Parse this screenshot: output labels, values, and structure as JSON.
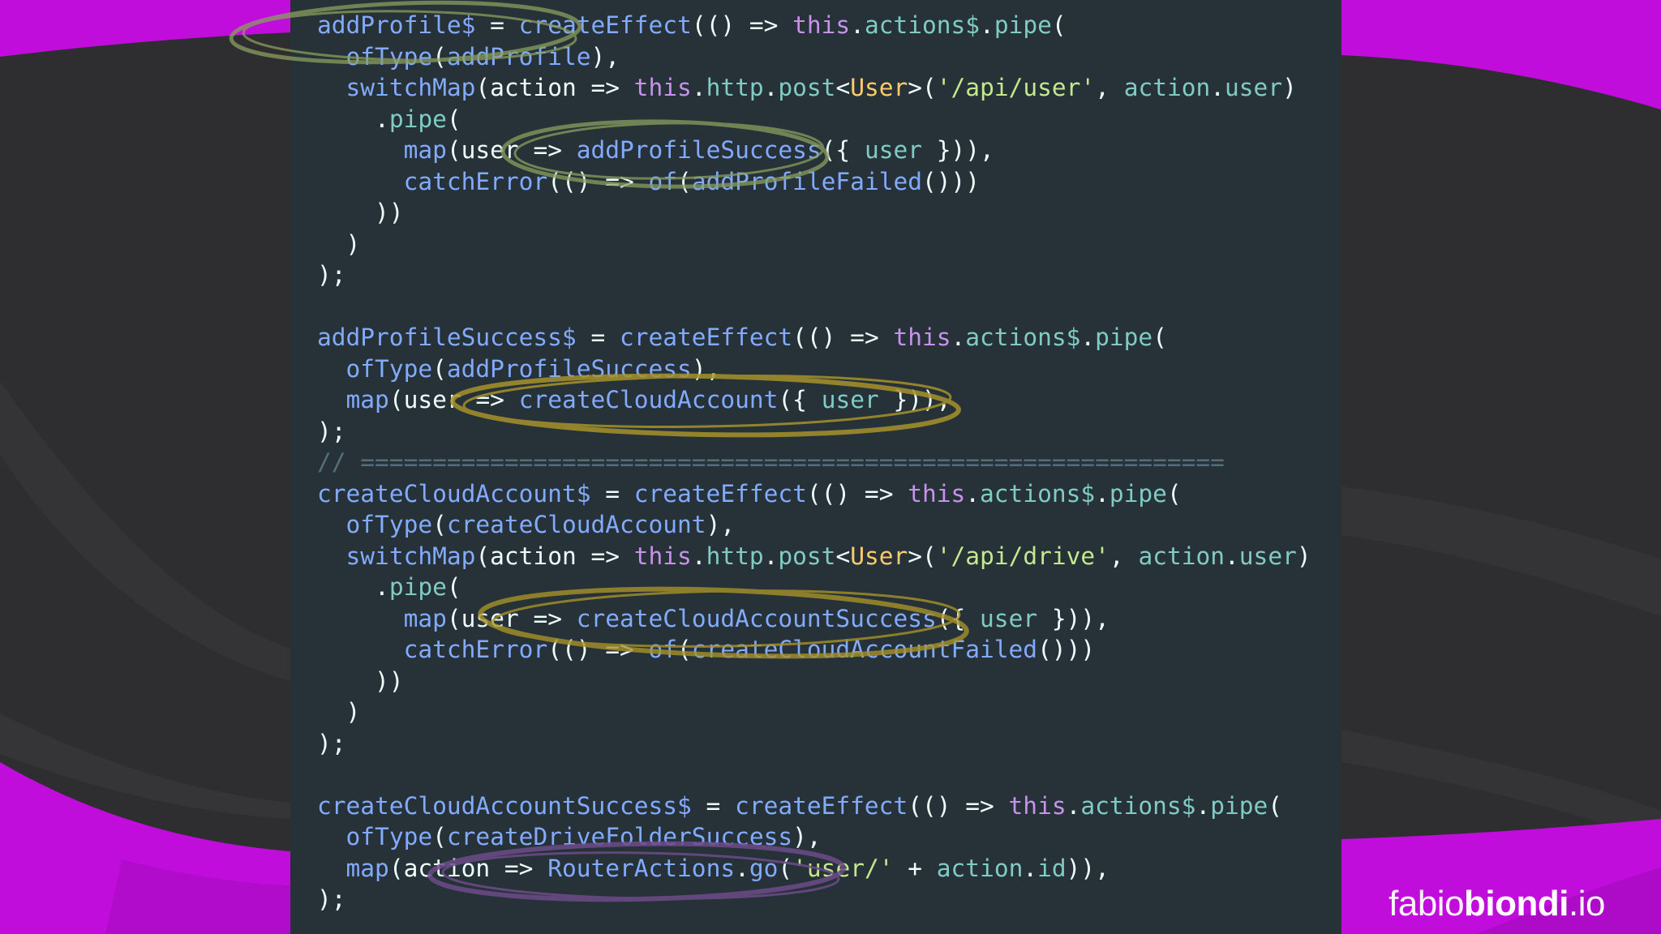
{
  "colors": {
    "background": "#2e2e31",
    "magenta": "#c10ddc",
    "panel": "#263238",
    "circle_green": "#8a9f5e",
    "circle_gold": "#a7922a",
    "circle_purple": "#6d4b8a"
  },
  "code_lines": [
    [
      {
        "t": "addProfile$",
        "c": "fn"
      },
      {
        "t": " = ",
        "c": "pl"
      },
      {
        "t": "createEffect",
        "c": "fn"
      },
      {
        "t": "(() => ",
        "c": "pl"
      },
      {
        "t": "this",
        "c": "kw"
      },
      {
        "t": ".",
        "c": "pl"
      },
      {
        "t": "actions$",
        "c": "pp"
      },
      {
        "t": ".",
        "c": "pl"
      },
      {
        "t": "pipe",
        "c": "pp"
      },
      {
        "t": "(",
        "c": "pl"
      }
    ],
    [
      {
        "t": "  ",
        "c": "pl"
      },
      {
        "t": "ofType",
        "c": "fn"
      },
      {
        "t": "(",
        "c": "pl"
      },
      {
        "t": "addProfile",
        "c": "fn"
      },
      {
        "t": "),",
        "c": "pl"
      }
    ],
    [
      {
        "t": "  ",
        "c": "pl"
      },
      {
        "t": "switchMap",
        "c": "fn"
      },
      {
        "t": "(action => ",
        "c": "pl"
      },
      {
        "t": "this",
        "c": "kw"
      },
      {
        "t": ".",
        "c": "pl"
      },
      {
        "t": "http",
        "c": "pp"
      },
      {
        "t": ".",
        "c": "pl"
      },
      {
        "t": "post",
        "c": "pp"
      },
      {
        "t": "<",
        "c": "pl"
      },
      {
        "t": "User",
        "c": "ty"
      },
      {
        "t": ">(",
        "c": "pl"
      },
      {
        "t": "'/api/user'",
        "c": "st"
      },
      {
        "t": ", ",
        "c": "pl"
      },
      {
        "t": "action",
        "c": "pp"
      },
      {
        "t": ".",
        "c": "pl"
      },
      {
        "t": "user",
        "c": "pp"
      },
      {
        "t": ")",
        "c": "pl"
      }
    ],
    [
      {
        "t": "    .",
        "c": "pl"
      },
      {
        "t": "pipe",
        "c": "pp"
      },
      {
        "t": "(",
        "c": "pl"
      }
    ],
    [
      {
        "t": "      ",
        "c": "pl"
      },
      {
        "t": "map",
        "c": "fn"
      },
      {
        "t": "(user => ",
        "c": "pl"
      },
      {
        "t": "addProfileSuccess",
        "c": "fn"
      },
      {
        "t": "({ ",
        "c": "pl"
      },
      {
        "t": "user",
        "c": "pp"
      },
      {
        "t": " })),",
        "c": "pl"
      }
    ],
    [
      {
        "t": "      ",
        "c": "pl"
      },
      {
        "t": "catchError",
        "c": "fn"
      },
      {
        "t": "(() => ",
        "c": "pl"
      },
      {
        "t": "of",
        "c": "fn"
      },
      {
        "t": "(",
        "c": "pl"
      },
      {
        "t": "addProfileFailed",
        "c": "fn"
      },
      {
        "t": "()))",
        "c": "pl"
      }
    ],
    [
      {
        "t": "    ))",
        "c": "pl"
      }
    ],
    [
      {
        "t": "  )",
        "c": "pl"
      }
    ],
    [
      {
        "t": ");",
        "c": "pl"
      }
    ],
    [],
    [
      {
        "t": "addProfileSuccess$",
        "c": "fn"
      },
      {
        "t": " = ",
        "c": "pl"
      },
      {
        "t": "createEffect",
        "c": "fn"
      },
      {
        "t": "(() => ",
        "c": "pl"
      },
      {
        "t": "this",
        "c": "kw"
      },
      {
        "t": ".",
        "c": "pl"
      },
      {
        "t": "actions$",
        "c": "pp"
      },
      {
        "t": ".",
        "c": "pl"
      },
      {
        "t": "pipe",
        "c": "pp"
      },
      {
        "t": "(",
        "c": "pl"
      }
    ],
    [
      {
        "t": "  ",
        "c": "pl"
      },
      {
        "t": "ofType",
        "c": "fn"
      },
      {
        "t": "(",
        "c": "pl"
      },
      {
        "t": "addProfileSuccess",
        "c": "fn"
      },
      {
        "t": "),",
        "c": "pl"
      }
    ],
    [
      {
        "t": "  ",
        "c": "pl"
      },
      {
        "t": "map",
        "c": "fn"
      },
      {
        "t": "(user => ",
        "c": "pl"
      },
      {
        "t": "createCloudAccount",
        "c": "fn"
      },
      {
        "t": "({ ",
        "c": "pl"
      },
      {
        "t": "user",
        "c": "pp"
      },
      {
        "t": " })),",
        "c": "pl"
      }
    ],
    [
      {
        "t": ");",
        "c": "pl"
      }
    ],
    [
      {
        "t": "// ============================================================",
        "c": "cm"
      }
    ],
    [
      {
        "t": "createCloudAccount$",
        "c": "fn"
      },
      {
        "t": " = ",
        "c": "pl"
      },
      {
        "t": "createEffect",
        "c": "fn"
      },
      {
        "t": "(() => ",
        "c": "pl"
      },
      {
        "t": "this",
        "c": "kw"
      },
      {
        "t": ".",
        "c": "pl"
      },
      {
        "t": "actions$",
        "c": "pp"
      },
      {
        "t": ".",
        "c": "pl"
      },
      {
        "t": "pipe",
        "c": "pp"
      },
      {
        "t": "(",
        "c": "pl"
      }
    ],
    [
      {
        "t": "  ",
        "c": "pl"
      },
      {
        "t": "ofType",
        "c": "fn"
      },
      {
        "t": "(",
        "c": "pl"
      },
      {
        "t": "createCloudAccount",
        "c": "fn"
      },
      {
        "t": "),",
        "c": "pl"
      }
    ],
    [
      {
        "t": "  ",
        "c": "pl"
      },
      {
        "t": "switchMap",
        "c": "fn"
      },
      {
        "t": "(action => ",
        "c": "pl"
      },
      {
        "t": "this",
        "c": "kw"
      },
      {
        "t": ".",
        "c": "pl"
      },
      {
        "t": "http",
        "c": "pp"
      },
      {
        "t": ".",
        "c": "pl"
      },
      {
        "t": "post",
        "c": "pp"
      },
      {
        "t": "<",
        "c": "pl"
      },
      {
        "t": "User",
        "c": "ty"
      },
      {
        "t": ">(",
        "c": "pl"
      },
      {
        "t": "'/api/drive'",
        "c": "st"
      },
      {
        "t": ", ",
        "c": "pl"
      },
      {
        "t": "action",
        "c": "pp"
      },
      {
        "t": ".",
        "c": "pl"
      },
      {
        "t": "user",
        "c": "pp"
      },
      {
        "t": ")",
        "c": "pl"
      }
    ],
    [
      {
        "t": "    .",
        "c": "pl"
      },
      {
        "t": "pipe",
        "c": "pp"
      },
      {
        "t": "(",
        "c": "pl"
      }
    ],
    [
      {
        "t": "      ",
        "c": "pl"
      },
      {
        "t": "map",
        "c": "fn"
      },
      {
        "t": "(user => ",
        "c": "pl"
      },
      {
        "t": "createCloudAccountSuccess",
        "c": "fn"
      },
      {
        "t": "({ ",
        "c": "pl"
      },
      {
        "t": "user",
        "c": "pp"
      },
      {
        "t": " })),",
        "c": "pl"
      }
    ],
    [
      {
        "t": "      ",
        "c": "pl"
      },
      {
        "t": "catchError",
        "c": "fn"
      },
      {
        "t": "(() => ",
        "c": "pl"
      },
      {
        "t": "of",
        "c": "fn"
      },
      {
        "t": "(",
        "c": "pl"
      },
      {
        "t": "createCloudAccountFailed",
        "c": "fn"
      },
      {
        "t": "()))",
        "c": "pl"
      }
    ],
    [
      {
        "t": "    ))",
        "c": "pl"
      }
    ],
    [
      {
        "t": "  )",
        "c": "pl"
      }
    ],
    [
      {
        "t": ");",
        "c": "pl"
      }
    ],
    [],
    [
      {
        "t": "createCloudAccountSuccess$",
        "c": "fn"
      },
      {
        "t": " = ",
        "c": "pl"
      },
      {
        "t": "createEffect",
        "c": "fn"
      },
      {
        "t": "(() => ",
        "c": "pl"
      },
      {
        "t": "this",
        "c": "kw"
      },
      {
        "t": ".",
        "c": "pl"
      },
      {
        "t": "actions$",
        "c": "pp"
      },
      {
        "t": ".",
        "c": "pl"
      },
      {
        "t": "pipe",
        "c": "pp"
      },
      {
        "t": "(",
        "c": "pl"
      }
    ],
    [
      {
        "t": "  ",
        "c": "pl"
      },
      {
        "t": "ofType",
        "c": "fn"
      },
      {
        "t": "(",
        "c": "pl"
      },
      {
        "t": "createDriveFolderSuccess",
        "c": "fn"
      },
      {
        "t": "),",
        "c": "pl"
      }
    ],
    [
      {
        "t": "  ",
        "c": "pl"
      },
      {
        "t": "map",
        "c": "fn"
      },
      {
        "t": "(action => ",
        "c": "pl"
      },
      {
        "t": "RouterActions",
        "c": "fn"
      },
      {
        "t": ".",
        "c": "pl"
      },
      {
        "t": "go",
        "c": "fn"
      },
      {
        "t": "(",
        "c": "pl"
      },
      {
        "t": "'user/'",
        "c": "st"
      },
      {
        "t": " + ",
        "c": "pl"
      },
      {
        "t": "action",
        "c": "pp"
      },
      {
        "t": ".",
        "c": "pl"
      },
      {
        "t": "id",
        "c": "pp"
      },
      {
        "t": ")),",
        "c": "pl"
      }
    ],
    [
      {
        "t": ");",
        "c": "pl"
      }
    ]
  ],
  "brand": {
    "light": "fabio",
    "bold": "biondi",
    "suffix": ".io"
  }
}
